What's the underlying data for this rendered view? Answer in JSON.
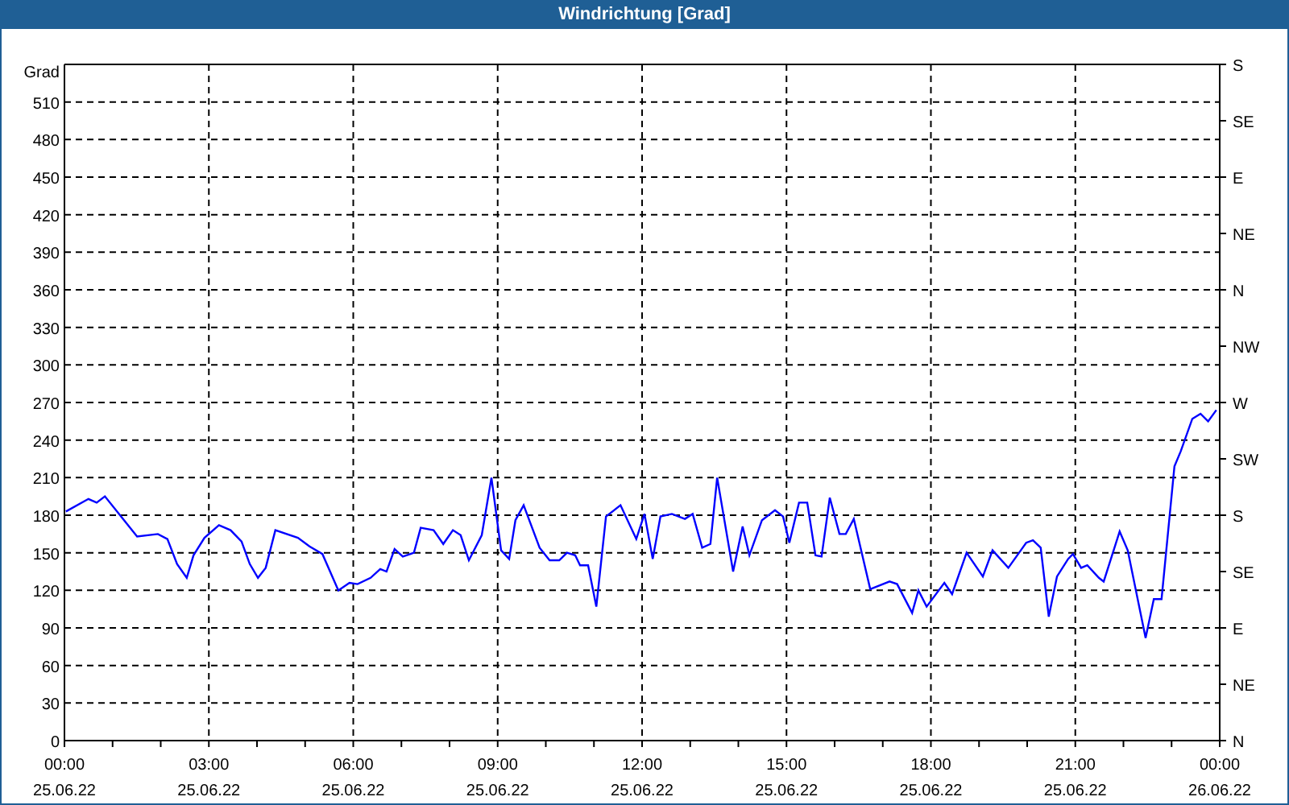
{
  "window": {
    "title": "Windrichtung [Grad]"
  },
  "chart": {
    "chart_data": {
      "type": "line",
      "ylabel": "Grad",
      "xlim": [
        0,
        24
      ],
      "ylim": [
        0,
        540
      ],
      "grid": true,
      "yticks": [
        0,
        30,
        60,
        90,
        120,
        150,
        180,
        210,
        240,
        270,
        300,
        330,
        360,
        390,
        420,
        450,
        480,
        510
      ],
      "xticks": [
        {
          "value": 0,
          "label": "00:00"
        },
        {
          "value": 3,
          "label": "03:00"
        },
        {
          "value": 6,
          "label": "06:00"
        },
        {
          "value": 9,
          "label": "09:00"
        },
        {
          "value": 12,
          "label": "12:00"
        },
        {
          "value": 15,
          "label": "15:00"
        },
        {
          "value": 18,
          "label": "18:00"
        },
        {
          "value": 21,
          "label": "21:00"
        },
        {
          "value": 24,
          "label": "00:00"
        }
      ],
      "x": [
        0.03,
        0.5,
        0.67,
        0.84,
        1.24,
        1.51,
        1.94,
        2.14,
        2.34,
        2.54,
        2.68,
        2.91,
        3.21,
        3.45,
        3.68,
        3.85,
        4.02,
        4.18,
        4.38,
        4.85,
        5.09,
        5.36,
        5.69,
        5.92,
        6.09,
        6.36,
        6.56,
        6.69,
        6.86,
        7.03,
        7.26,
        7.4,
        7.67,
        7.87,
        8.07,
        8.23,
        8.4,
        8.67,
        8.87,
        9.07,
        9.24,
        9.37,
        9.54,
        9.87,
        10.08,
        10.28,
        10.44,
        10.61,
        10.71,
        10.88,
        11.05,
        11.25,
        11.55,
        11.88,
        12.05,
        12.22,
        12.38,
        12.62,
        12.89,
        13.05,
        13.25,
        13.42,
        13.56,
        13.89,
        14.09,
        14.23,
        14.49,
        14.76,
        14.93,
        15.06,
        15.26,
        15.43,
        15.6,
        15.73,
        15.9,
        16.1,
        16.23,
        16.4,
        16.74,
        17.14,
        17.3,
        17.61,
        17.74,
        17.91,
        18.28,
        18.44,
        18.74,
        19.08,
        19.28,
        19.61,
        19.98,
        20.12,
        20.28,
        20.45,
        20.62,
        20.85,
        20.95,
        21.12,
        21.25,
        21.49,
        21.59,
        21.92,
        22.09,
        22.46,
        22.63,
        22.79,
        23.06,
        23.19,
        23.43,
        23.6,
        23.76,
        23.93
      ],
      "series": [
        {
          "color": "#0000ff",
          "values": [
            183,
            193,
            190,
            195,
            176,
            163,
            165,
            161,
            141,
            130,
            148,
            162,
            172,
            168,
            159,
            141,
            130,
            138,
            168,
            162,
            155,
            149,
            120,
            126,
            125,
            130,
            137,
            135,
            153,
            147,
            150,
            170,
            168,
            157,
            168,
            164,
            144,
            164,
            210,
            152,
            145,
            176,
            188,
            154,
            144,
            144,
            150,
            148,
            140,
            140,
            107,
            179,
            188,
            161,
            181,
            145,
            179,
            181,
            177,
            181,
            154,
            157,
            210,
            135,
            171,
            148,
            176,
            184,
            179,
            158,
            190,
            190,
            148,
            147,
            194,
            165,
            165,
            177,
            121,
            127,
            125,
            102,
            120,
            107,
            126,
            117,
            150,
            131,
            152,
            138,
            158,
            160,
            154,
            99,
            131,
            145,
            149,
            138,
            140,
            130,
            127,
            167,
            152,
            82,
            113,
            113,
            219,
            231,
            257,
            261,
            255,
            264
          ]
        }
      ]
    },
    "x_axis_dates": [
      "25.06.22",
      "25.06.22",
      "25.06.22",
      "25.06.22",
      "25.06.22",
      "25.06.22",
      "25.06.22",
      "25.06.22",
      "26.06.22"
    ],
    "right_axis": {
      "labels": [
        "S",
        "SE",
        "E",
        "NE",
        "N",
        "NW",
        "W",
        "SW",
        "S",
        "SE",
        "E",
        "NE",
        "N"
      ]
    }
  }
}
